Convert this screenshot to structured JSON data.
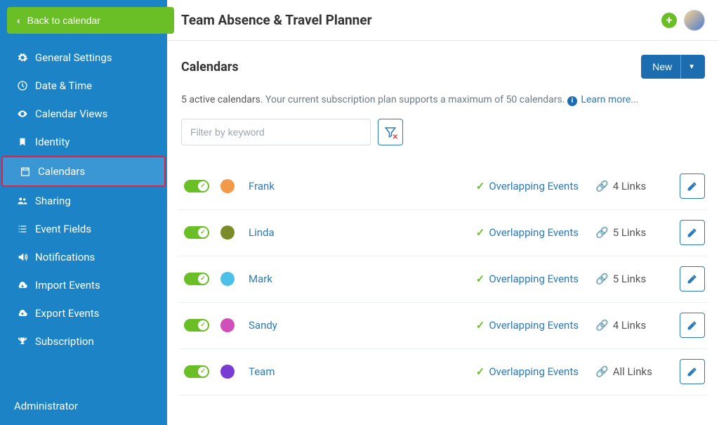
{
  "back_label": "Back to calendar",
  "app_title": "Team Absence & Travel Planner",
  "footer_role": "Administrator",
  "sidebar": {
    "items": [
      {
        "label": "General Settings",
        "icon": "gear"
      },
      {
        "label": "Date & Time",
        "icon": "clock"
      },
      {
        "label": "Calendar Views",
        "icon": "eye"
      },
      {
        "label": "Identity",
        "icon": "bookmark"
      },
      {
        "label": "Calendars",
        "icon": "calendar",
        "active": true,
        "highlight": true
      },
      {
        "label": "Sharing",
        "icon": "group"
      },
      {
        "label": "Event Fields",
        "icon": "list"
      },
      {
        "label": "Notifications",
        "icon": "sound"
      },
      {
        "label": "Import Events",
        "icon": "cloud-down"
      },
      {
        "label": "Export Events",
        "icon": "cloud-up"
      },
      {
        "label": "Subscription",
        "icon": "trophy"
      }
    ]
  },
  "page": {
    "heading": "Calendars",
    "new_button": "New",
    "active_count_text": "5 active calendars.",
    "plan_note": "Your current subscription plan supports a maximum of 50 calendars.",
    "learn_more": "Learn more...",
    "filter_placeholder": "Filter by keyword"
  },
  "calendars": [
    {
      "name": "Frank",
      "color": "#f2994a",
      "overlapping_label": "Overlapping Events",
      "links_text": "4 Links"
    },
    {
      "name": "Linda",
      "color": "#7a8c2a",
      "overlapping_label": "Overlapping Events",
      "links_text": "5 Links"
    },
    {
      "name": "Mark",
      "color": "#4cc0e6",
      "overlapping_label": "Overlapping Events",
      "links_text": "5 Links"
    },
    {
      "name": "Sandy",
      "color": "#d04fb9",
      "overlapping_label": "Overlapping Events",
      "links_text": "4 Links"
    },
    {
      "name": "Team",
      "color": "#7a3bd3",
      "overlapping_label": "Overlapping Events",
      "links_text": "All Links"
    }
  ]
}
